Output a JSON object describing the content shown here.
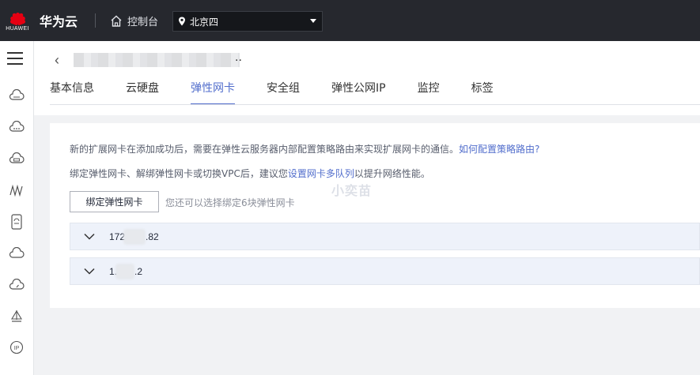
{
  "topbar": {
    "logo_text": "HUAWEI",
    "brand": "华为云",
    "console_label": "控制台",
    "region": "北京四"
  },
  "header": {
    "title_suffix": "..",
    "tabs": [
      {
        "label": "基本信息"
      },
      {
        "label": "云硬盘"
      },
      {
        "label": "弹性网卡"
      },
      {
        "label": "安全组"
      },
      {
        "label": "弹性公网IP"
      },
      {
        "label": "监控"
      },
      {
        "label": "标签"
      }
    ],
    "active_tab": "弹性网卡"
  },
  "panel": {
    "note1_text": "新的扩展网卡在添加成功后，需要在弹性云服务器内部配置策略路由来实现扩展网卡的通信。",
    "note1_link": "如何配置策略路由?",
    "note2_prefix": "绑定弹性网卡、解绑弹性网卡或切换VPC后，建议您",
    "note2_link": "设置网卡多队列",
    "note2_suffix": "以提升网络性能。",
    "watermark": "小奕苗",
    "bind_button": "绑定弹性网卡",
    "hint": "您还可以选择绑定6块弹性网卡",
    "nics": [
      {
        "ip_start": "172",
        "ip_end": ".82"
      },
      {
        "ip_start": "1.",
        "ip_end": ".2"
      }
    ]
  },
  "colors": {
    "accent": "#526ecc",
    "topbar_bg": "#26282e",
    "row_bg": "#eef2fa"
  }
}
